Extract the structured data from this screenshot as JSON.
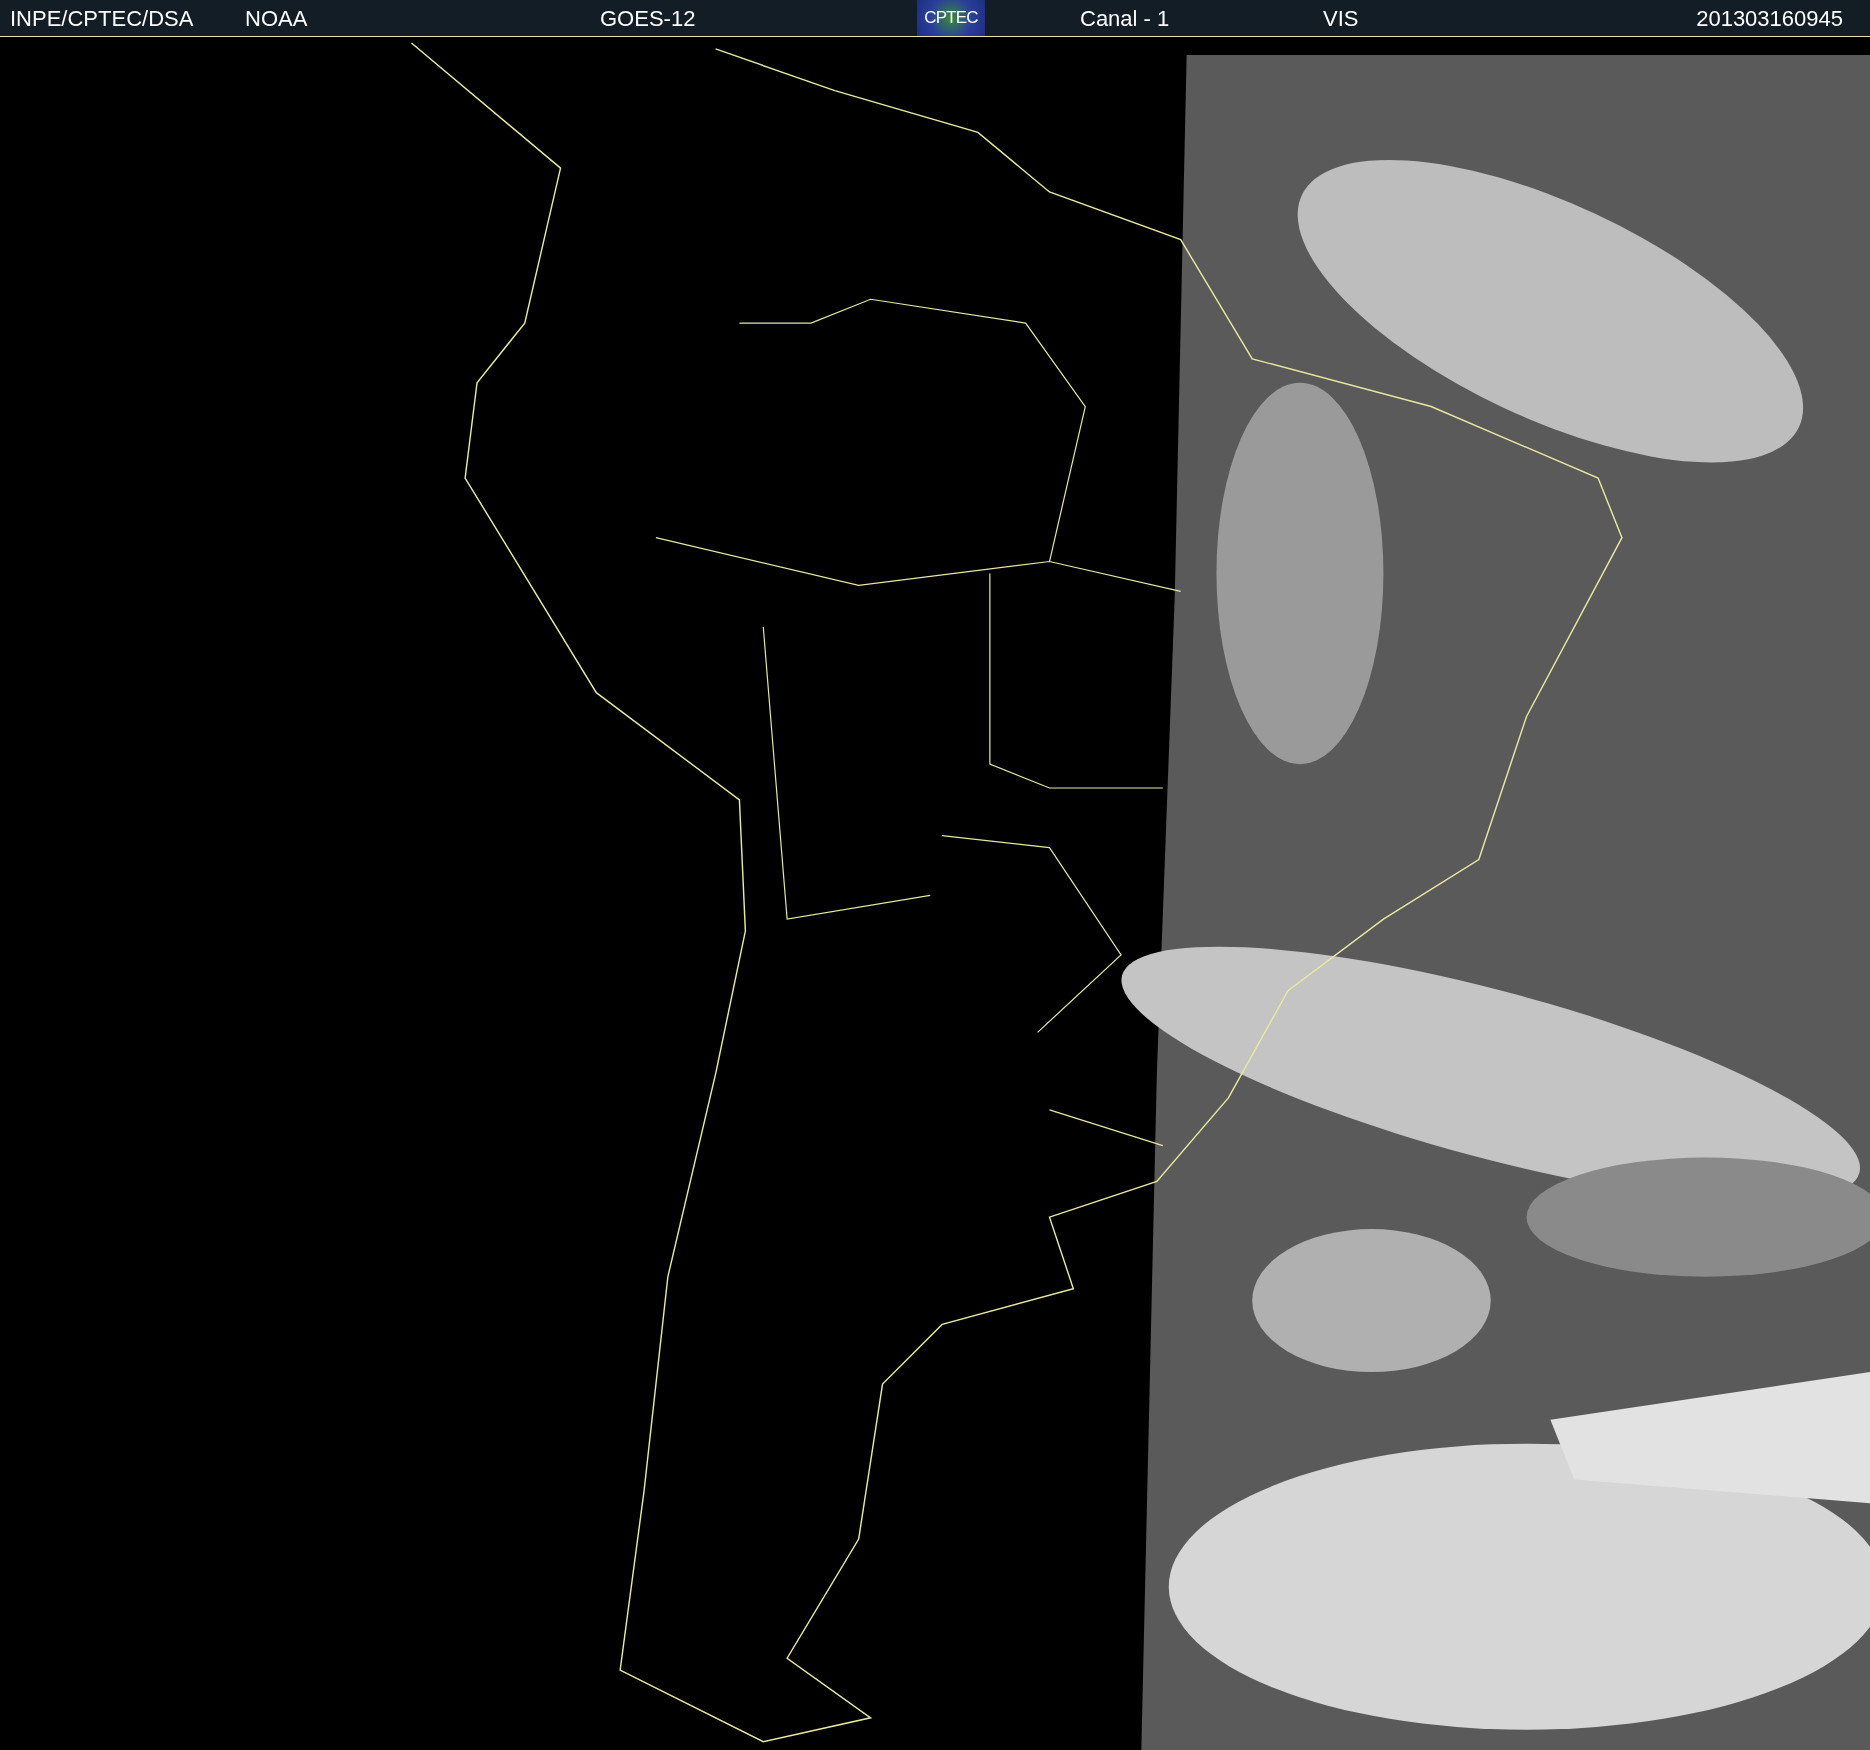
{
  "header": {
    "source": "INPE/CPTEC/DSA",
    "agency": "NOAA",
    "satellite": "GOES-12",
    "logo": "CPTEC",
    "channel": "Canal - 1",
    "band": "VIS",
    "timestamp": "201303160945"
  }
}
